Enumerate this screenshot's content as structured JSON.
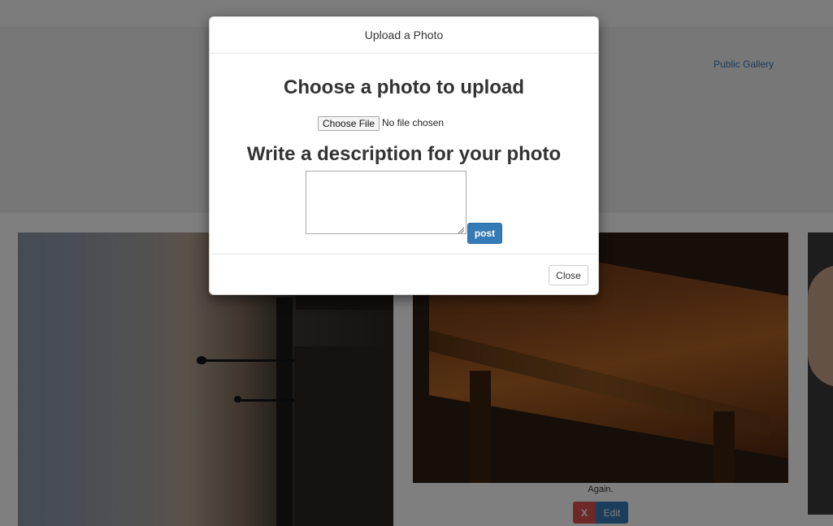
{
  "nav": {
    "public_gallery_label": "Public Gallery"
  },
  "gallery": {
    "items": [
      {
        "caption": "",
        "alt": ""
      },
      {
        "caption": "Again.",
        "delete_label": "X",
        "edit_label": "Edit"
      },
      {
        "caption": ""
      }
    ]
  },
  "modal": {
    "title": "Upload a Photo",
    "choose_heading": "Choose a photo to upload",
    "file_button_label": "Choose File",
    "file_status": "No file chosen",
    "description_heading": "Write a description for your photo",
    "description_value": "",
    "post_label": "post",
    "close_label": "Close"
  },
  "colors": {
    "primary": "#337ab7",
    "danger": "#d9534f",
    "backdrop": "rgba(0,0,0,0.5)"
  }
}
